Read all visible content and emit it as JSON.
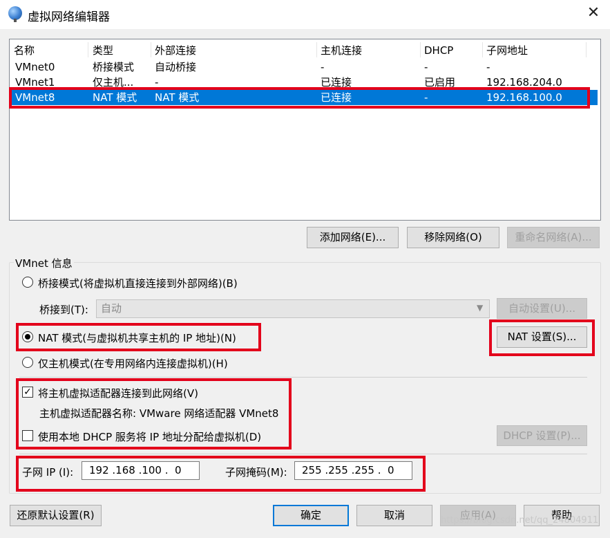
{
  "window": {
    "title": "虚拟网络编辑器",
    "close_glyph": "✕"
  },
  "table": {
    "columns": [
      "名称",
      "类型",
      "外部连接",
      "主机连接",
      "DHCP",
      "子网地址"
    ],
    "rows": [
      [
        "VMnet0",
        "桥接模式",
        "自动桥接",
        "-",
        "-",
        "-"
      ],
      [
        "VMnet1",
        "仅主机...",
        "-",
        "已连接",
        "已启用",
        "192.168.204.0"
      ],
      [
        "VMnet8",
        "NAT 模式",
        "NAT 模式",
        "已连接",
        "-",
        "192.168.100.0"
      ]
    ],
    "selected_row": 2
  },
  "buttons": {
    "add_network": "添加网络(E)...",
    "remove_network": "移除网络(O)",
    "rename_network": "重命名网络(A)...",
    "auto_settings": "自动设置(U)...",
    "nat_settings": "NAT 设置(S)...",
    "dhcp_settings": "DHCP 设置(P)...",
    "restore_defaults": "还原默认设置(R)",
    "ok": "确定",
    "cancel": "取消",
    "apply": "应用(A)",
    "help": "帮助"
  },
  "vmnet_info": {
    "group_title": "VMnet 信息",
    "bridged_label": "桥接模式(将虚拟机直接连接到外部网络)(B)",
    "bridge_to_label": "桥接到(T):",
    "bridge_to_value": "自动",
    "nat_label": "NAT 模式(与虚拟机共享主机的 IP 地址)(N)",
    "host_only_label": "仅主机模式(在专用网络内连接虚拟机)(H)",
    "selected_mode": "nat",
    "connect_adapter_label": "将主机虚拟适配器连接到此网络(V)",
    "connect_adapter_checked": true,
    "adapter_name_label": "主机虚拟适配器名称: VMware 网络适配器 VMnet8",
    "use_dhcp_label": "使用本地 DHCP 服务将 IP 地址分配给虚拟机(D)",
    "use_dhcp_checked": false,
    "subnet_ip_label": "子网 IP (I):",
    "subnet_ip_value": "192 .168 .100 .  0",
    "subnet_mask_label": "子网掩码(M):",
    "subnet_mask_value": "255 .255 .255 .  0"
  },
  "watermark": "https://blog.csdn.net/qq_24804911",
  "colors": {
    "selection": "#0078d7",
    "highlight_box": "#e3001b",
    "default_button_border": "#0078d7"
  }
}
